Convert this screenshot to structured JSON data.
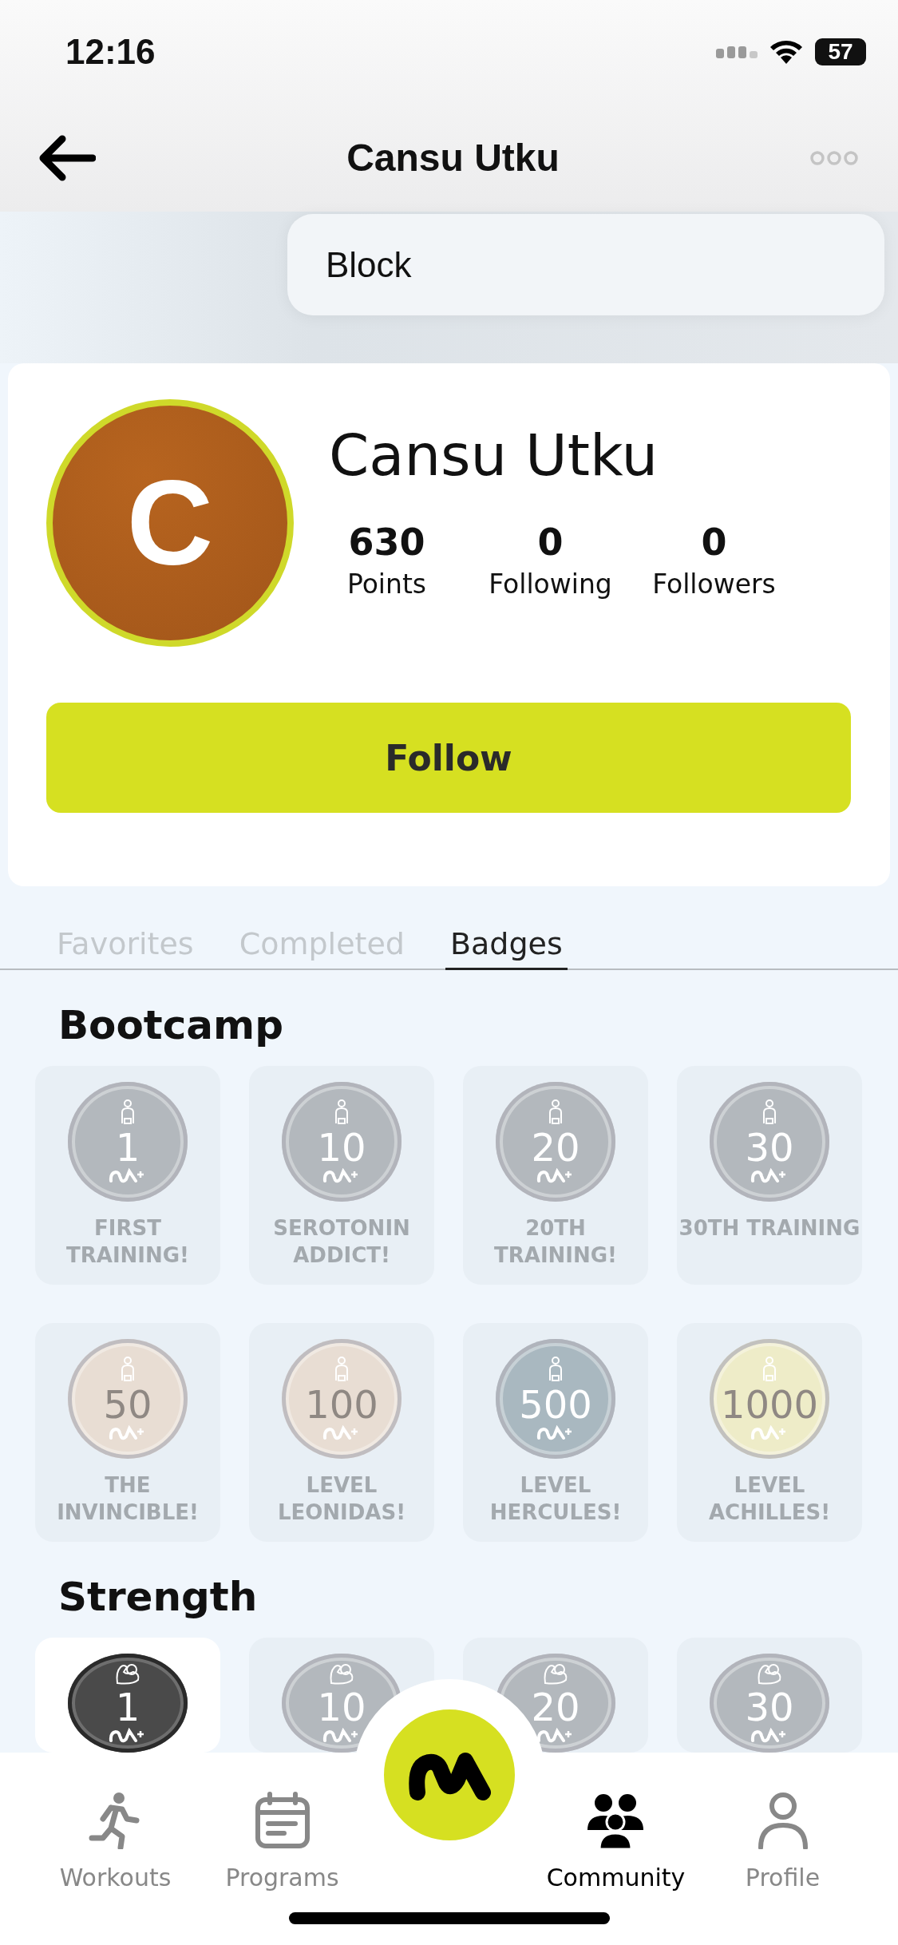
{
  "status_bar": {
    "time": "12:16",
    "battery": "57"
  },
  "nav": {
    "title": "Cansu Utku"
  },
  "menu": {
    "items": [
      "Block"
    ]
  },
  "profile": {
    "avatar_initial": "C",
    "name": "Cansu Utku",
    "follow_button": "Follow",
    "stats": [
      {
        "value": "630",
        "label": "Points"
      },
      {
        "value": "0",
        "label": "Following"
      },
      {
        "value": "0",
        "label": "Followers"
      }
    ]
  },
  "tabs": [
    {
      "label": "Favorites",
      "selected": false
    },
    {
      "label": "Completed",
      "selected": false
    },
    {
      "label": "Badges",
      "selected": true
    }
  ],
  "sections": [
    {
      "title": "Bootcamp",
      "kind": "bootcamp",
      "badges": [
        {
          "number": "1",
          "label": "FIRST TRAINING!",
          "color": "#b3b8bd",
          "earned": false
        },
        {
          "number": "10",
          "label": "SEROTONIN ADDICT!",
          "color": "#b3b8bd",
          "earned": false
        },
        {
          "number": "20",
          "label": "20TH TRAINING!",
          "color": "#b3b8bd",
          "earned": false
        },
        {
          "number": "30",
          "label": "30TH TRAINING",
          "color": "#b3b8bd",
          "earned": false
        },
        {
          "number": "50",
          "label": "THE INVINCIBLE!",
          "color": "#e8ddd3",
          "earned": false
        },
        {
          "number": "100",
          "label": "LEVEL LEONIDAS!",
          "color": "#e8ddd3",
          "earned": false
        },
        {
          "number": "500",
          "label": "LEVEL HERCULES!",
          "color": "#a9b8c0",
          "earned": false
        },
        {
          "number": "1000",
          "label": "LEVEL ACHILLES!",
          "color": "#eeecc8",
          "earned": false
        }
      ]
    },
    {
      "title": "Strength",
      "kind": "strength",
      "badges": [
        {
          "number": "1",
          "color": "#4a4a4a",
          "earned": true
        },
        {
          "number": "10",
          "color": "#b3b8bd",
          "earned": false
        },
        {
          "number": "20",
          "color": "#b3b8bd",
          "earned": false
        },
        {
          "number": "30",
          "color": "#b3b8bd",
          "earned": false
        }
      ]
    }
  ],
  "tab_bar": [
    {
      "label": "Workouts",
      "selected": false
    },
    {
      "label": "Programs",
      "selected": false
    },
    {
      "label": "Community",
      "selected": true
    },
    {
      "label": "Profile",
      "selected": false
    }
  ]
}
